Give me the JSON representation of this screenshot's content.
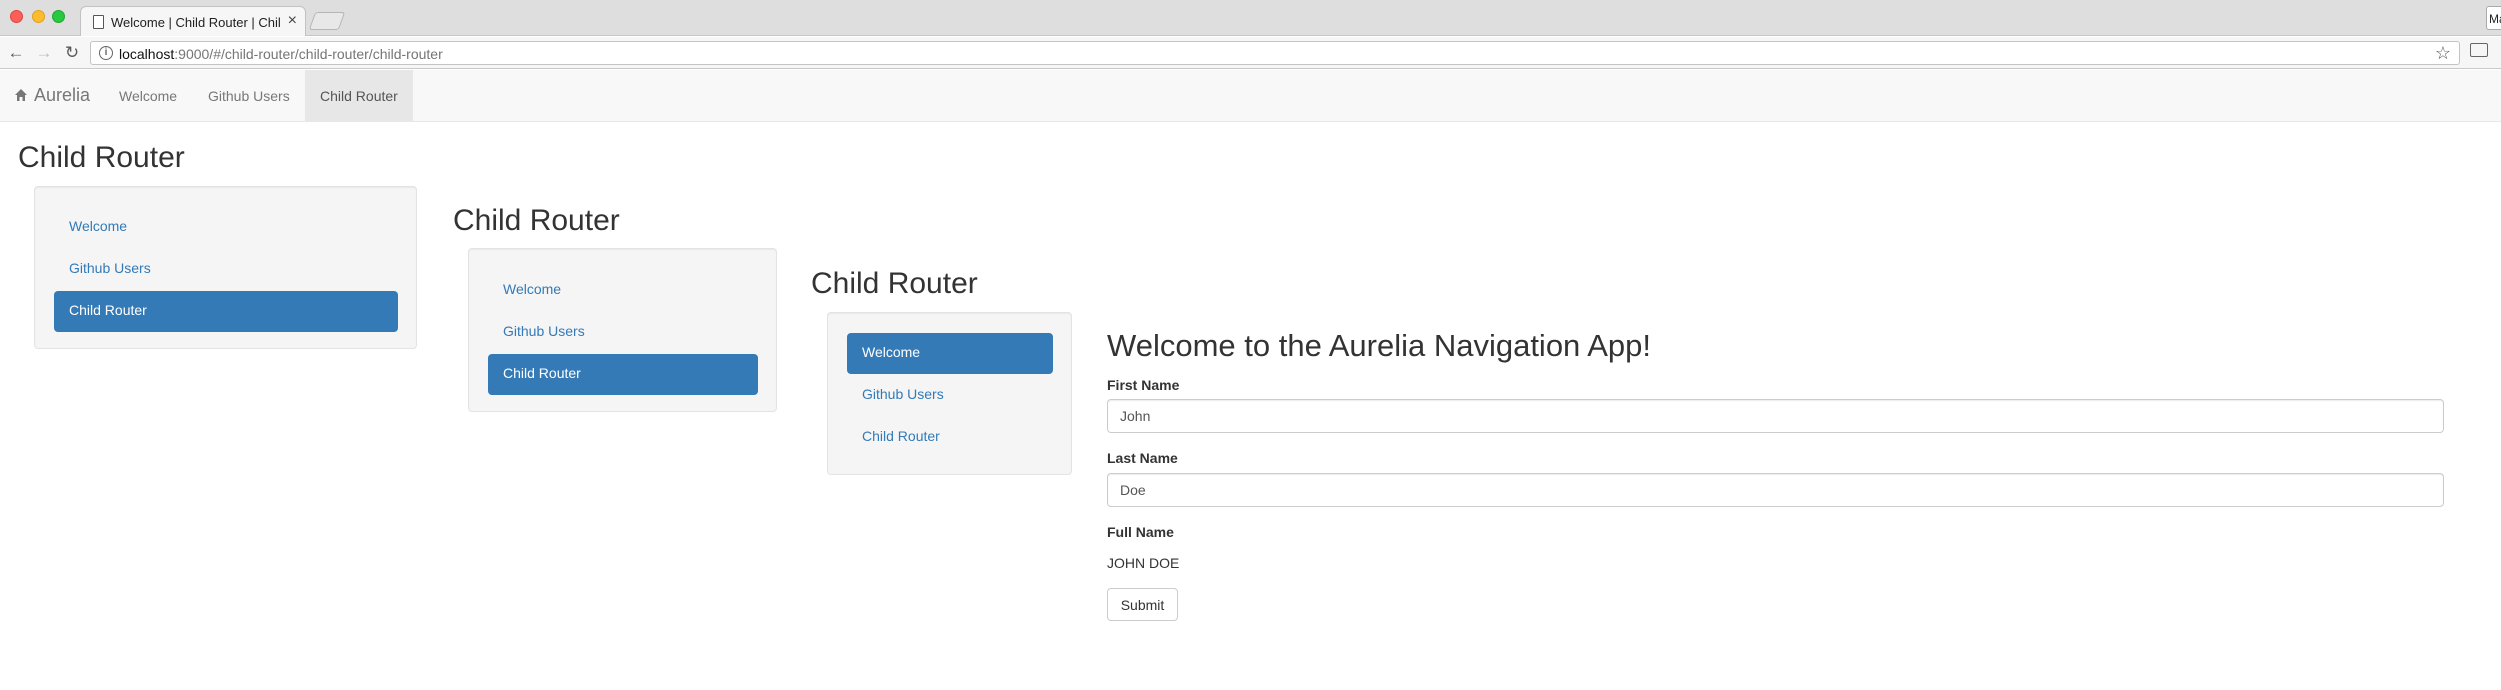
{
  "browser": {
    "tab_title": "Welcome | Child Router | Child Router",
    "profile_label": "Ma",
    "url_host": "localhost",
    "url_rest": ":9000/#/child-router/child-router/child-router"
  },
  "navbar": {
    "brand": "Aurelia",
    "items": [
      {
        "label": "Welcome"
      },
      {
        "label": "Github Users"
      },
      {
        "label": "Child Router",
        "active": true
      }
    ]
  },
  "router_levels": [
    {
      "title": "Child Router",
      "items": [
        {
          "label": "Welcome"
        },
        {
          "label": "Github Users"
        },
        {
          "label": "Child Router",
          "active": true
        }
      ]
    },
    {
      "title": "Child Router",
      "items": [
        {
          "label": "Welcome"
        },
        {
          "label": "Github Users"
        },
        {
          "label": "Child Router",
          "active": true
        }
      ]
    },
    {
      "title": "Child Router",
      "items": [
        {
          "label": "Welcome",
          "active": true
        },
        {
          "label": "Github Users"
        },
        {
          "label": "Child Router"
        }
      ]
    }
  ],
  "welcome": {
    "heading": "Welcome to the Aurelia Navigation App!",
    "first_name_label": "First Name",
    "first_name_value": "John",
    "last_name_label": "Last Name",
    "last_name_value": "Doe",
    "full_name_label": "Full Name",
    "full_name_value": "JOHN DOE",
    "submit_label": "Submit"
  },
  "colors": {
    "primary": "#337ab7",
    "link": "#337ab7",
    "navbar_bg": "#f8f8f8",
    "well_bg": "#f5f5f5"
  }
}
